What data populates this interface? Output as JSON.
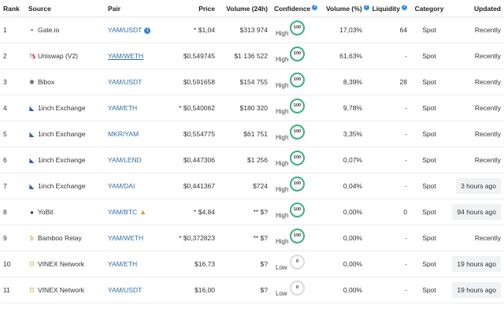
{
  "headers": {
    "rank": "Rank",
    "source": "Source",
    "pair": "Pair",
    "price": "Price",
    "volume24h": "Volume (24h)",
    "confidence": "Confidence",
    "volume_pct": "Volume (%)",
    "liquidity": "Liquidity",
    "category": "Category",
    "updated": "Updated"
  },
  "rows": [
    {
      "rank": "1",
      "source": "Gate.io",
      "source_icon": "gateio-icon",
      "pair": "YAM/USDT",
      "pair_underline": false,
      "pair_flag": "info",
      "price": "* $1,04",
      "volume": "$313 974",
      "conf_label": "High",
      "conf_score": "100",
      "vol_pct": "17,03%",
      "liquidity": "64",
      "category": "Spot",
      "updated": "Recently",
      "updated_badge": false
    },
    {
      "rank": "2",
      "source": "Uniswap (V2)",
      "source_icon": "uniswap-icon",
      "pair": "YAM/WETH",
      "pair_underline": true,
      "pair_flag": "",
      "price": "$0,549745",
      "volume": "$1 136 522",
      "conf_label": "High",
      "conf_score": "100",
      "vol_pct": "61,63%",
      "liquidity": "-",
      "category": "Spot",
      "updated": "Recently",
      "updated_badge": false
    },
    {
      "rank": "3",
      "source": "Bibox",
      "source_icon": "bibox-icon",
      "pair": "YAM/USDT",
      "pair_underline": false,
      "pair_flag": "",
      "price": "$0,591658",
      "volume": "$154 755",
      "conf_label": "High",
      "conf_score": "100",
      "vol_pct": "8,39%",
      "liquidity": "28",
      "category": "Spot",
      "updated": "Recently",
      "updated_badge": false
    },
    {
      "rank": "4",
      "source": "1inch Exchange",
      "source_icon": "1inch-icon",
      "pair": "YAM/ETH",
      "pair_underline": false,
      "pair_flag": "",
      "price": "* $0,540062",
      "volume": "$180 320",
      "conf_label": "High",
      "conf_score": "100",
      "vol_pct": "9,78%",
      "liquidity": "-",
      "category": "Spot",
      "updated": "Recently",
      "updated_badge": false
    },
    {
      "rank": "5",
      "source": "1inch Exchange",
      "source_icon": "1inch-icon",
      "pair": "MKR/YAM",
      "pair_underline": false,
      "pair_flag": "",
      "price": "$0,554775",
      "volume": "$61 751",
      "conf_label": "High",
      "conf_score": "100",
      "vol_pct": "3,35%",
      "liquidity": "-",
      "category": "Spot",
      "updated": "Recently",
      "updated_badge": false
    },
    {
      "rank": "6",
      "source": "1inch Exchange",
      "source_icon": "1inch-icon",
      "pair": "YAM/LEND",
      "pair_underline": false,
      "pair_flag": "",
      "price": "$0,447306",
      "volume": "$1 256",
      "conf_label": "High",
      "conf_score": "100",
      "vol_pct": "0,07%",
      "liquidity": "-",
      "category": "Spot",
      "updated": "Recently",
      "updated_badge": false
    },
    {
      "rank": "7",
      "source": "1inch Exchange",
      "source_icon": "1inch-icon",
      "pair": "YAM/DAI",
      "pair_underline": false,
      "pair_flag": "",
      "price": "$0,441367",
      "volume": "$724",
      "conf_label": "High",
      "conf_score": "100",
      "vol_pct": "0,04%",
      "liquidity": "-",
      "category": "Spot",
      "updated": "3 hours ago",
      "updated_badge": true
    },
    {
      "rank": "8",
      "source": "YoBit",
      "source_icon": "yobit-icon",
      "pair": "YAM/BTC",
      "pair_underline": false,
      "pair_flag": "warn",
      "price": "* $4,84",
      "volume": "** $?",
      "conf_label": "High",
      "conf_score": "100",
      "vol_pct": "0,00%",
      "liquidity": "0",
      "category": "Spot",
      "updated": "94 hours ago",
      "updated_badge": true
    },
    {
      "rank": "9",
      "source": "Bamboo Relay",
      "source_icon": "bamboo-icon",
      "pair": "YAM/WETH",
      "pair_underline": false,
      "pair_flag": "",
      "price": "* $0,372823",
      "volume": "** $?",
      "conf_label": "High",
      "conf_score": "100",
      "vol_pct": "0,00%",
      "liquidity": "-",
      "category": "Spot",
      "updated": "Recently",
      "updated_badge": false
    },
    {
      "rank": "10",
      "source": "VINEX Network",
      "source_icon": "vinex-icon",
      "pair": "YAM/ETH",
      "pair_underline": false,
      "pair_flag": "",
      "price": "$16,73",
      "volume": "$?",
      "conf_label": "Low",
      "conf_score": "0",
      "vol_pct": "0,00%",
      "liquidity": "-",
      "category": "Spot",
      "updated": "19 hours ago",
      "updated_badge": true
    },
    {
      "rank": "11",
      "source": "VINEX Network",
      "source_icon": "vinex-icon",
      "pair": "YAM/USDT",
      "pair_underline": false,
      "pair_flag": "",
      "price": "$16,00",
      "volume": "$?",
      "conf_label": "Low",
      "conf_score": "0",
      "vol_pct": "0,00%",
      "liquidity": "-",
      "category": "Spot",
      "updated": "19 hours ago",
      "updated_badge": true
    }
  ],
  "icon_glyphs": {
    "gateio-icon": "◓",
    "uniswap-icon": "🦄",
    "bibox-icon": "❋",
    "1inch-icon": "◣",
    "yobit-icon": "●",
    "bamboo-icon": "ɓ",
    "vinex-icon": "Ʊ"
  },
  "icon_colors": {
    "gateio-icon": "#d8373f",
    "uniswap-icon": "#ff007a",
    "bibox-icon": "#333333",
    "1inch-icon": "#2b5fa8",
    "yobit-icon": "#1b3a78",
    "bamboo-icon": "#c59a2d",
    "vinex-icon": "#e2a52b"
  },
  "colors": {
    "high_ring": "#3bb27c",
    "low_ring": "#dcdcdc",
    "link": "#2f6ea8"
  }
}
